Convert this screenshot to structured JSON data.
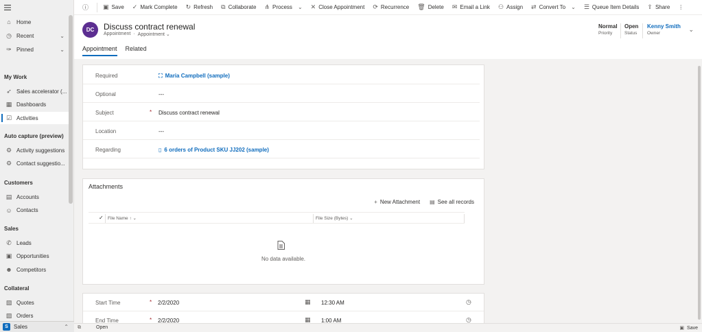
{
  "sidebar": {
    "items_top": [
      {
        "label": "Home",
        "icon": "home-icon",
        "glyph": "⌂"
      },
      {
        "label": "Recent",
        "icon": "clock-icon",
        "glyph": "◷",
        "chevron": "⌄"
      },
      {
        "label": "Pinned",
        "icon": "pin-icon",
        "glyph": "✑",
        "chevron": "⌄"
      }
    ],
    "sections": [
      {
        "title": "My Work",
        "items": [
          {
            "label": "Sales accelerator (...",
            "icon": "rocket-icon",
            "glyph": "➶"
          },
          {
            "label": "Dashboards",
            "icon": "dashboard-icon",
            "glyph": "▦"
          },
          {
            "label": "Activities",
            "icon": "activities-icon",
            "glyph": "☑",
            "active": true
          }
        ]
      },
      {
        "title": "Auto capture (preview)",
        "items": [
          {
            "label": "Activity suggestions",
            "icon": "gear-icon",
            "glyph": "⚙"
          },
          {
            "label": "Contact suggestio...",
            "icon": "gear-icon",
            "glyph": "⚙"
          }
        ]
      },
      {
        "title": "Customers",
        "items": [
          {
            "label": "Accounts",
            "icon": "building-icon",
            "glyph": "▤"
          },
          {
            "label": "Contacts",
            "icon": "person-icon",
            "glyph": "☺"
          }
        ]
      },
      {
        "title": "Sales",
        "items": [
          {
            "label": "Leads",
            "icon": "phone-icon",
            "glyph": "✆"
          },
          {
            "label": "Opportunities",
            "icon": "opportunity-icon",
            "glyph": "▣"
          },
          {
            "label": "Competitors",
            "icon": "competitor-icon",
            "glyph": "☻"
          }
        ]
      },
      {
        "title": "Collateral",
        "items": [
          {
            "label": "Quotes",
            "icon": "quote-icon",
            "glyph": "▧"
          },
          {
            "label": "Orders",
            "icon": "order-icon",
            "glyph": "▨"
          }
        ]
      }
    ],
    "app_badge": "S",
    "app_name": "Sales"
  },
  "commands": [
    {
      "label": "Save",
      "icon": "save-icon",
      "glyph": "▣"
    },
    {
      "label": "Mark Complete",
      "icon": "check-icon",
      "glyph": "✓"
    },
    {
      "label": "Refresh",
      "icon": "refresh-icon",
      "glyph": "↻"
    },
    {
      "label": "Collaborate",
      "icon": "collaborate-icon",
      "glyph": "⧉"
    },
    {
      "label": "Process",
      "icon": "process-icon",
      "glyph": "⋔",
      "dropdown": "⌄"
    },
    {
      "label": "Close Appointment",
      "icon": "close-icon",
      "glyph": "✕"
    },
    {
      "label": "Recurrence",
      "icon": "recurrence-icon",
      "glyph": "⟳"
    },
    {
      "label": "Delete",
      "icon": "delete-icon",
      "glyph": "🗑"
    },
    {
      "label": "Email a Link",
      "icon": "email-icon",
      "glyph": "✉"
    },
    {
      "label": "Assign",
      "icon": "assign-icon",
      "glyph": "⚇"
    },
    {
      "label": "Convert To",
      "icon": "convert-icon",
      "glyph": "⇄",
      "dropdown": "⌄"
    },
    {
      "label": "Queue Item Details",
      "icon": "queue-icon",
      "glyph": "☰"
    },
    {
      "label": "Share",
      "icon": "share-icon",
      "glyph": "⇪"
    }
  ],
  "header": {
    "avatar": "DC",
    "title": "Discuss contract renewal",
    "entity": "Appointment",
    "form": "Appointment",
    "priority": {
      "value": "Normal",
      "label": "Priority"
    },
    "status": {
      "value": "Open",
      "label": "Status"
    },
    "owner": {
      "value": "Kenny Smith",
      "label": "Owner"
    },
    "tabs": [
      "Appointment",
      "Related"
    ]
  },
  "fields": [
    {
      "label": "Required",
      "value": "Maria Campbell (sample)",
      "link": true,
      "icon": "contact-icon",
      "glyph": "⛶"
    },
    {
      "label": "Optional",
      "value": "---"
    },
    {
      "label": "Subject",
      "value": "Discuss contract renewal",
      "required": true
    },
    {
      "label": "Location",
      "value": "---"
    },
    {
      "label": "Regarding",
      "value": "6 orders of Product SKU JJ202 (sample)",
      "link": true,
      "icon": "document-icon",
      "glyph": "▯"
    }
  ],
  "attachments": {
    "title": "Attachments",
    "new_label": "New Attachment",
    "see_all_label": "See all records",
    "col_file_name": "File Name",
    "col_file_size": "File Size (Bytes)",
    "empty": "No data available."
  },
  "times": [
    {
      "label": "Start Time",
      "date": "2/2/2020",
      "time": "12:30 AM"
    },
    {
      "label": "End Time",
      "date": "2/2/2020",
      "time": "1:00 AM"
    }
  ],
  "required_mark": "*",
  "statusbar": {
    "status": "Open",
    "save": "Save"
  }
}
